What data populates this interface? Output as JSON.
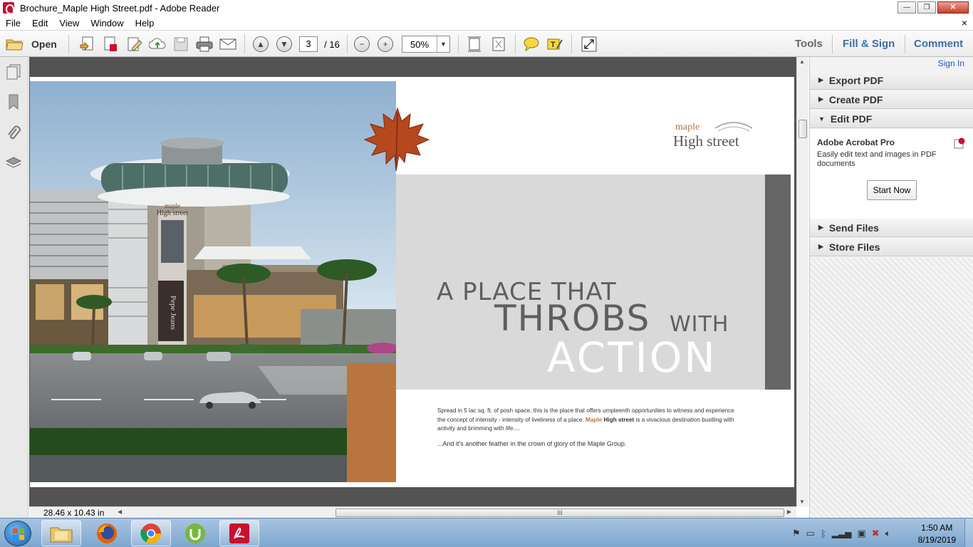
{
  "window": {
    "title": "Brochure_Maple High Street.pdf - Adobe Reader",
    "minimize": "—",
    "restore": "❐",
    "close": "✕"
  },
  "menu": [
    "File",
    "Edit",
    "View",
    "Window",
    "Help"
  ],
  "menu_close": "×",
  "toolbar": {
    "open_label": "Open",
    "current_page": "3",
    "page_total": "/ 16",
    "zoom": "50%",
    "tools": "Tools",
    "fill_sign": "Fill & Sign",
    "comment": "Comment"
  },
  "status": {
    "dimensions": "28.46 x 10.43 in",
    "scroll_grip": "III"
  },
  "brochure": {
    "logo_small": "maple",
    "logo_big": "High street",
    "headline_1": "A PLACE THAT",
    "headline_2": "THROBS",
    "headline_3": "WITH",
    "headline_4": "ACTION",
    "body_1": "Spread in 5 lac sq. ft. of posh space, this is the place that offers umpteenth opportunities to witness and experience the concept of intensity - intensity of liveliness of a place.",
    "body_brand_1": "Maple",
    "body_brand_2": "High street",
    "body_2": "is a vivacious destination bustling with activity and brimming with life....",
    "body_3": "...And it's another feather in the crown of glory of the Maple Group.",
    "store_sign": "Pepe Jeans",
    "building_sign_small": "maple",
    "building_sign_big": "High street"
  },
  "right_panel": {
    "sign_in": "Sign In",
    "export_pdf": "Export PDF",
    "create_pdf": "Create PDF",
    "edit_pdf": "Edit PDF",
    "promo_title": "Adobe Acrobat Pro",
    "promo_desc": "Easily edit text and images in PDF documents",
    "start_now": "Start Now",
    "send_files": "Send Files",
    "store_files": "Store Files"
  },
  "taskbar": {
    "time": "1:50 AM",
    "date": "8/19/2019"
  },
  "colors": {
    "accent_orange": "#b8763e",
    "link_blue": "#1f5db3",
    "dark_band": "#666666",
    "headline_gray": "#5f5f5f"
  }
}
